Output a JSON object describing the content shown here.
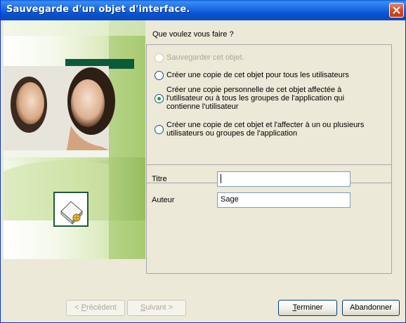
{
  "window": {
    "title": "Sauvegarde d'un objet d'interface."
  },
  "question": "Que voulez vous faire ?",
  "options": [
    {
      "label": "Sauvegarder cet objet.",
      "enabled": false,
      "checked": false
    },
    {
      "label": "Créer une copie de cet objet pour tous les utilisateurs",
      "enabled": true,
      "checked": false
    },
    {
      "label_lines": [
        "Créer une copie personnelle de cet objet affectée à",
        "l'utilisateur ou à tous les groupes de l'application qui",
        "contienne l'utilisateur"
      ],
      "enabled": true,
      "checked": true
    },
    {
      "label_lines": [
        "Créer une copie de cet objet et l'affecter à un ou plusieurs",
        "utilisateurs ou groupes de l'application"
      ],
      "enabled": true,
      "checked": false
    }
  ],
  "fields": {
    "titre": {
      "label": "Titre",
      "value": ""
    },
    "auteur": {
      "label": "Auteur",
      "value": "Sage"
    }
  },
  "buttons": {
    "previous": {
      "prefix": "< ",
      "mnemonic": "P",
      "rest": "récédent",
      "enabled": false
    },
    "next": {
      "mnemonic": "S",
      "rest": "uivant >",
      "enabled": false
    },
    "finish": {
      "mnemonic": "T",
      "rest": "erminer",
      "enabled": true
    },
    "cancel": {
      "label": "Abandonner",
      "enabled": true
    }
  },
  "colors": {
    "titlebar": "#0a5fd8",
    "side_green": "#8fb85a",
    "dark_green": "#0b5b3a",
    "radio_dot": "#21a121"
  }
}
